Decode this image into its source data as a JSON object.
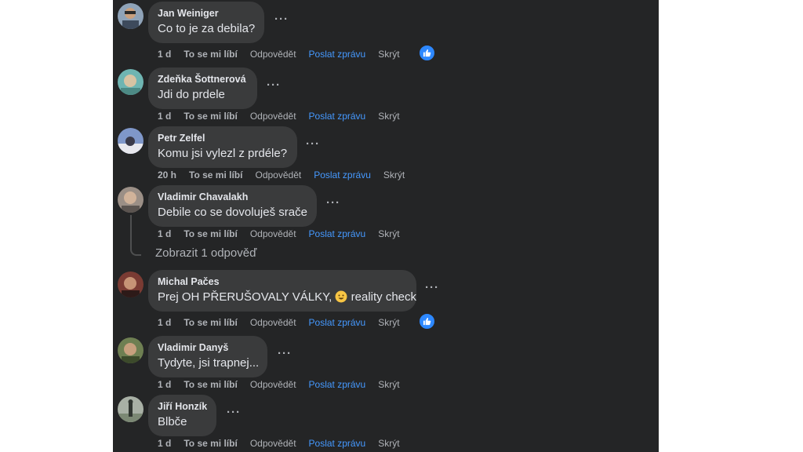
{
  "comments": [
    {
      "author": "Jan Weiniger",
      "text": "Co to je za debila?",
      "time": "1 d",
      "liked": true
    },
    {
      "author": "Zdeňka Šottnerová",
      "text": "Jdi do prdele",
      "time": "1 d",
      "liked": false
    },
    {
      "author": "Petr Zelfel",
      "text": "Komu jsi vylezl z prdéle?",
      "time": "20 h",
      "liked": false
    },
    {
      "author": "Vladimir Chavalakh",
      "text": "Debile co se dovoluješ srače",
      "time": "1 d",
      "liked": false
    },
    {
      "author": "Michal Pačes",
      "text_before": "Prej OH PŘERUŠOVALY VÁLKY,",
      "text_after": "reality check",
      "time": "1 d",
      "liked": true
    },
    {
      "author": "Vladimir Danyš",
      "text": "Tydyte, jsi trapnej...",
      "time": "1 d",
      "liked": false
    },
    {
      "author": "Jiří Honzík",
      "text": "Blbče",
      "time": "1 d",
      "liked": false
    }
  ],
  "actions": {
    "like": "To se mi líbí",
    "reply": "Odpovědět",
    "message": "Poslat zprávu",
    "hide": "Skrýt"
  },
  "more_glyph": "···",
  "view_replies": "Zobrazit 1 odpověď",
  "colors": {
    "panel": "#242526",
    "bubble": "#3a3b3c",
    "link": "#4599ff",
    "like_badge": "#2d88ff"
  }
}
